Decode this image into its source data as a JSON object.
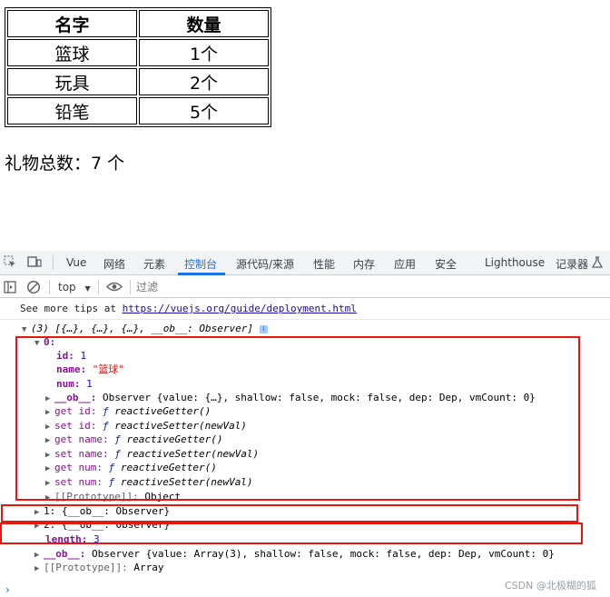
{
  "table": {
    "headers": [
      "名字",
      "数量"
    ],
    "rows": [
      {
        "name": "篮球",
        "count": "1个"
      },
      {
        "name": "玩具",
        "count": "2个"
      },
      {
        "name": "铅笔",
        "count": "5个"
      }
    ]
  },
  "total": {
    "label": "礼物总数：",
    "value": "7 个"
  },
  "devtools": {
    "tabs": [
      "Vue",
      "网络",
      "元素",
      "控制台",
      "源代码/来源",
      "性能",
      "内存",
      "应用",
      "安全",
      "Lighthouse",
      "记录器"
    ],
    "active_tab": "控制台",
    "context_select": "top",
    "filter_placeholder": "过滤",
    "accent_color": "#1a73e8",
    "icons": [
      "inspect-element-icon",
      "device-toolbar-icon",
      "sidebar-toggle-icon",
      "clear-console-icon",
      "eye-icon",
      "dropdown-arrow-icon",
      "info-icon"
    ]
  },
  "console": {
    "tips_prefix": "See more tips at ",
    "tips_link": "https://vuejs.org/guide/deployment.html",
    "array_summary": "(3) [{…}, {…}, {…}, __ob__: Observer]",
    "item0_key": "0:",
    "id_key": "id:",
    "id_val": "1",
    "name_key": "name:",
    "name_val": "\"篮球\"",
    "num_key": "num:",
    "num_val": "1",
    "ob_key": "__ob__:",
    "ob0_text": "Observer {value: {…}, shallow: false, mock: false, dep: Dep, vmCount: 0}",
    "getset": [
      {
        "key": "get id:",
        "fn": "reactiveGetter()"
      },
      {
        "key": "set id:",
        "fn": "reactiveSetter(newVal)"
      },
      {
        "key": "get name:",
        "fn": "reactiveGetter()"
      },
      {
        "key": "set name:",
        "fn": "reactiveSetter(newVal)"
      },
      {
        "key": "get num:",
        "fn": "reactiveGetter()"
      },
      {
        "key": "set num:",
        "fn": "reactiveSetter(newVal)"
      }
    ],
    "f_symbol": "ƒ",
    "proto_key": "[[Prototype]]:",
    "proto0_val": "Object",
    "item1": "1: {__ob__: Observer}",
    "item2": "2: {__ob__: Observer}",
    "length_key": "length:",
    "length_val": "3",
    "ob_root_text": "Observer {value: Array(3), shallow: false, mock: false, dep: Dep, vmCount: 0}",
    "proto_root_val": "Array",
    "prompt": "›"
  },
  "watermark": "CSDN @北极糊的狐"
}
